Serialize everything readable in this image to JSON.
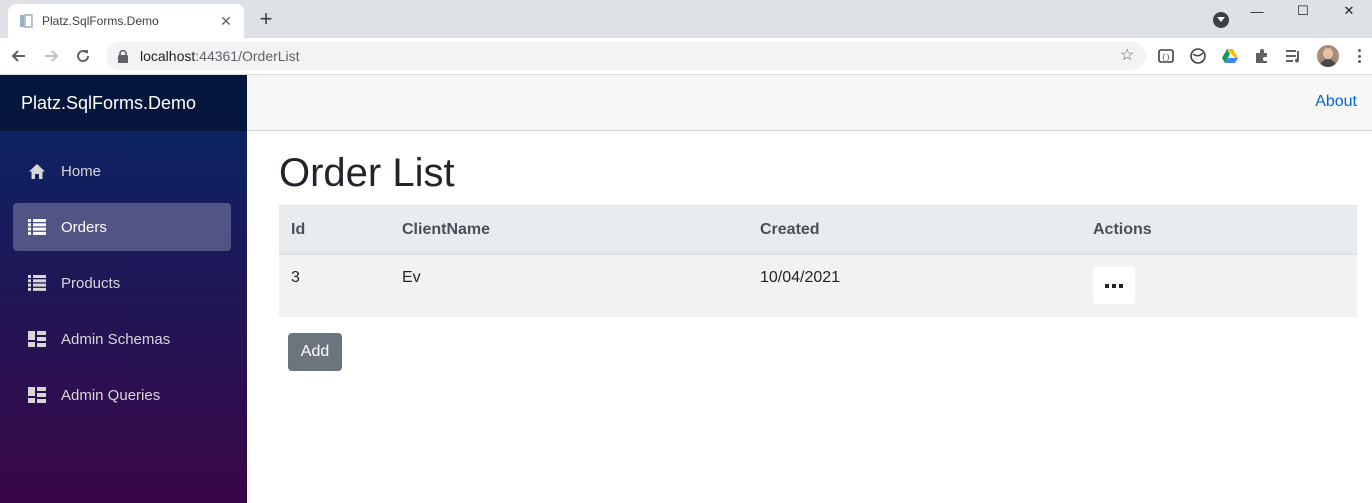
{
  "browser": {
    "tab_title": "Platz.SqlForms.Demo",
    "url_host": "localhost",
    "url_path": ":44361/OrderList",
    "close_glyph": "✕",
    "newtab_glyph": "+",
    "win_min": "—",
    "win_max": "☐",
    "win_close": "✕"
  },
  "sidebar": {
    "brand": "Platz.SqlForms.Demo",
    "items": [
      {
        "label": "Home",
        "icon": "home-icon"
      },
      {
        "label": "Orders",
        "icon": "list-icon"
      },
      {
        "label": "Products",
        "icon": "list-icon"
      },
      {
        "label": "Admin Schemas",
        "icon": "dashboard-icon"
      },
      {
        "label": "Admin Queries",
        "icon": "dashboard-icon"
      }
    ],
    "active_index": 1
  },
  "topbar": {
    "about_label": "About"
  },
  "main": {
    "title": "Order List",
    "columns": [
      "Id",
      "ClientName",
      "Created",
      "Actions"
    ],
    "rows": [
      {
        "id": "3",
        "client": "Ev",
        "created": "10/04/2021"
      }
    ],
    "add_label": "Add"
  },
  "colors": {
    "sidebar_top": "#052767",
    "sidebar_bottom": "#3a0647",
    "link": "#0366d6",
    "add_button": "#6c757d"
  }
}
